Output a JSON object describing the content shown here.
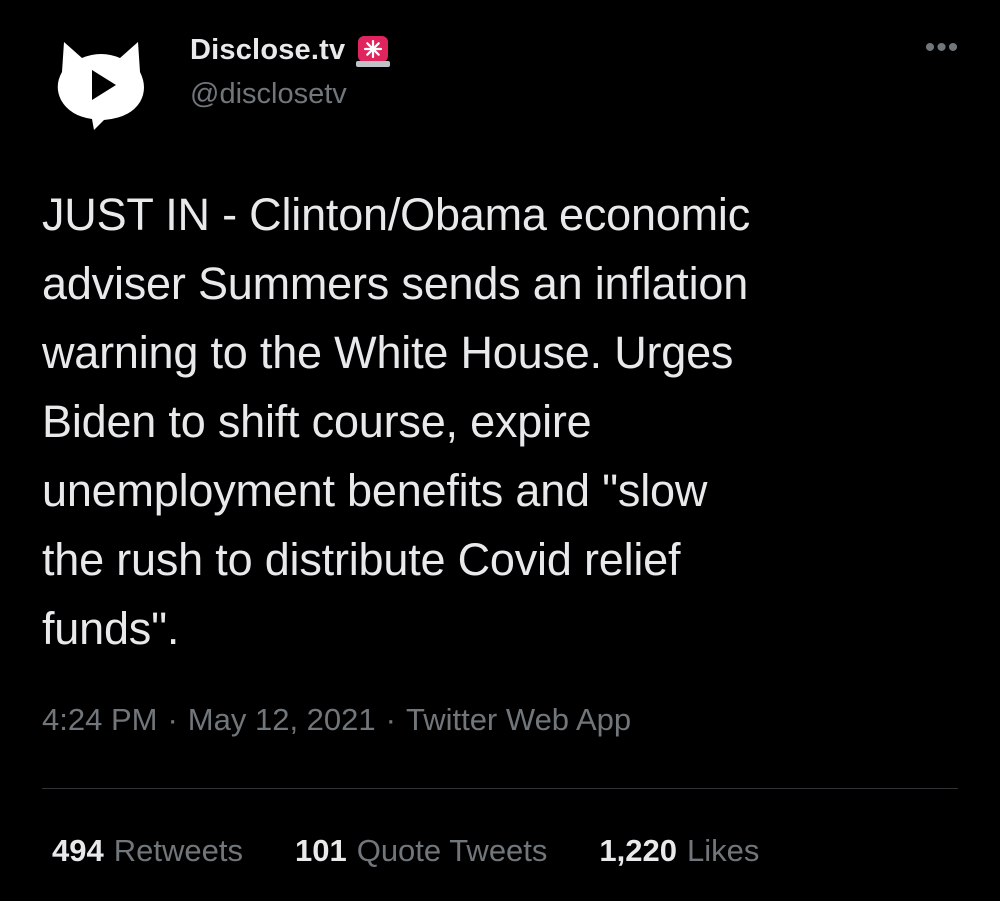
{
  "account": {
    "display_name": "Disclose.tv",
    "handle": "@disclosetv",
    "avatar_icon": "play-cat-logo-icon",
    "badge_icon": "police-siren-icon"
  },
  "menu": {
    "more_icon": "more-options-icon"
  },
  "tweet": {
    "text": "JUST IN - Clinton/Obama economic\nadviser Summers sends an inflation\nwarning to the White House. Urges\nBiden to shift course, expire\nunemployment benefits and \"slow\nthe rush to distribute Covid relief\nfunds\"."
  },
  "meta": {
    "time": "4:24 PM",
    "separator": "·",
    "date": "May 12, 2021",
    "source": "Twitter Web App"
  },
  "stats": {
    "retweets_count": "494",
    "retweets_label": "Retweets",
    "quotes_count": "101",
    "quotes_label": "Quote Tweets",
    "likes_count": "1,220",
    "likes_label": "Likes"
  },
  "colors": {
    "background": "#000000",
    "primary_text": "#e7e9ea",
    "secondary_text": "#71767b",
    "divider": "#2f3336",
    "siren_red": "#e0245e"
  }
}
